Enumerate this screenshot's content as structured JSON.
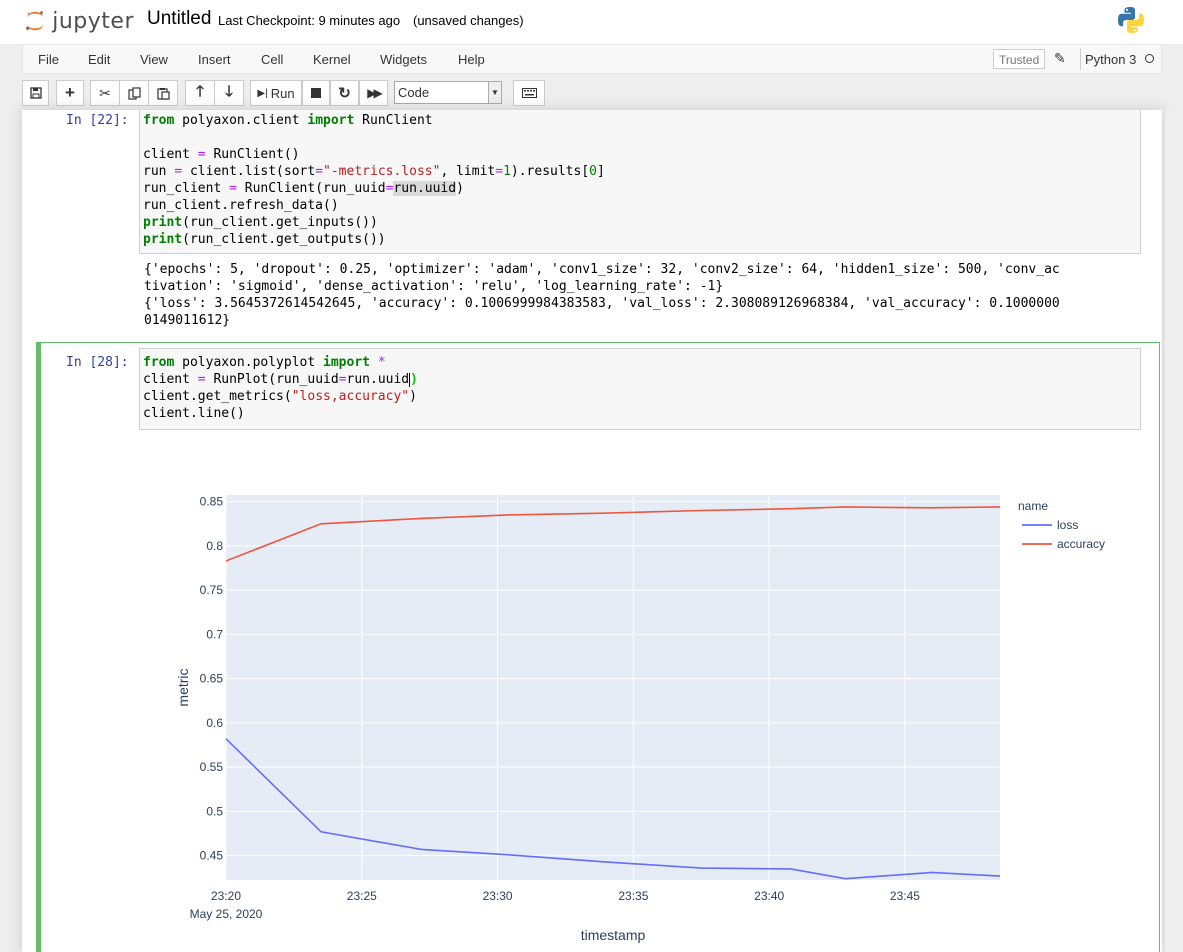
{
  "header": {
    "logo_text": "jupyter",
    "notebook_name": "Untitled",
    "checkpoint": "Last Checkpoint: 9 minutes ago",
    "unsaved": "(unsaved changes)"
  },
  "menu": {
    "items": [
      "File",
      "Edit",
      "View",
      "Insert",
      "Cell",
      "Kernel",
      "Widgets",
      "Help"
    ],
    "trusted": "Trusted",
    "kernel": "Python 3"
  },
  "toolbar": {
    "run_label": "Run",
    "cell_type": "Code"
  },
  "cell1": {
    "prompt": "In [22]:",
    "output_lines": [
      "{'epochs': 5, 'dropout': 0.25, 'optimizer': 'adam', 'conv1_size': 32, 'conv2_size': 64, 'hidden1_size': 500, 'conv_ac",
      "tivation': 'sigmoid', 'dense_activation': 'relu', 'log_learning_rate': -1}",
      "{'loss': 3.5645372614542645, 'accuracy': 0.1006999984383583, 'val_loss': 2.308089126968384, 'val_accuracy': 0.1000000",
      "0149011612}"
    ]
  },
  "cell2": {
    "prompt": "In [28]:"
  },
  "colors": {
    "loss": "#636efa",
    "accuracy": "#ef553b",
    "plot_bg": "#e5ecf6",
    "selected_cell": "#66bb6a"
  },
  "chart_data": {
    "type": "line",
    "x": [
      "23:20",
      "23:23.5",
      "23:27.2",
      "23:30.4",
      "23:33.9",
      "23:37.5",
      "23:40.8",
      "23:42.8",
      "23:46",
      "23:48.5"
    ],
    "x_ticks": [
      "23:20",
      "23:25",
      "23:30",
      "23:35",
      "23:40",
      "23:45"
    ],
    "x_date": "May 25, 2020",
    "xlabel": "timestamp",
    "ylabel": "metric",
    "ylim": [
      0.4225,
      0.8575
    ],
    "y_ticks": [
      "0.85",
      "0.8",
      "0.75",
      "0.7",
      "0.65",
      "0.6",
      "0.55",
      "0.5",
      "0.45"
    ],
    "legend_title": "name",
    "legend_position": "top-right",
    "grid": true,
    "series": [
      {
        "name": "loss",
        "values": [
          0.582,
          0.477,
          0.457,
          0.451,
          0.443,
          0.436,
          0.435,
          0.424,
          0.431,
          0.427
        ]
      },
      {
        "name": "accuracy",
        "values": [
          0.783,
          0.825,
          0.831,
          0.835,
          0.837,
          0.84,
          0.842,
          0.844,
          0.843,
          0.844
        ]
      }
    ]
  }
}
